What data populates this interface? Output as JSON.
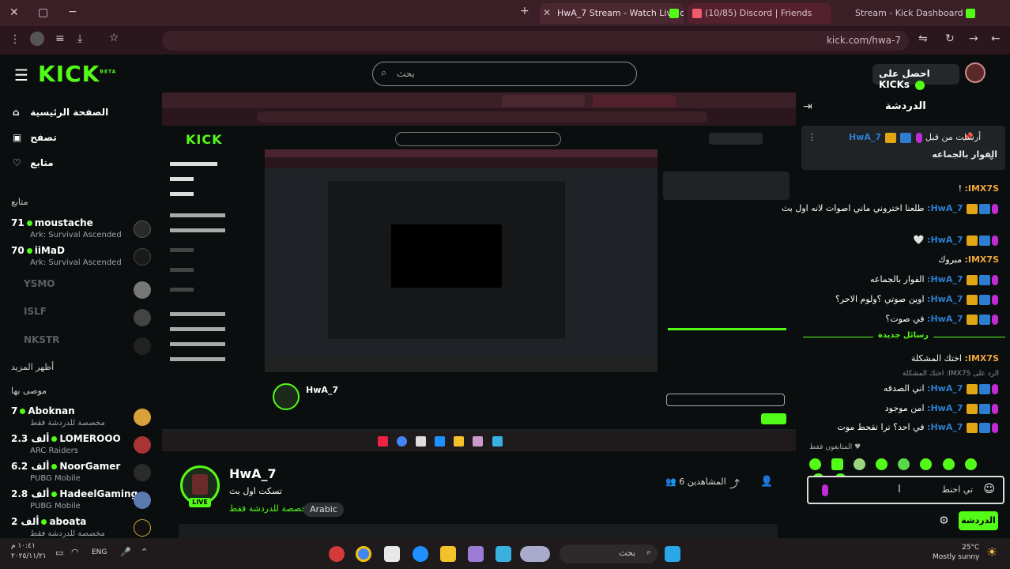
{
  "browser": {
    "tabs": [
      {
        "label": "HwA_7 Stream - Watch Live on",
        "active": true
      },
      {
        "label": "(10/85) Discord | Friends",
        "active": false
      },
      {
        "label": "Stream - Kick Dashboard",
        "active": false
      }
    ],
    "url": "kick.com/hwa-7"
  },
  "header": {
    "logo": "KICK",
    "logo_sup": "BETA",
    "search_placeholder": "بحث",
    "get_kicks_label": "احصل على KICKs"
  },
  "sidebar": {
    "nav": [
      {
        "label": "الصفحة الرئيسية",
        "icon": "home-icon"
      },
      {
        "label": "تصفح",
        "icon": "browse-icon"
      },
      {
        "label": "متابع",
        "icon": "heart-icon"
      }
    ],
    "following_title": "متابع",
    "following": [
      {
        "viewers": "71",
        "name": "moustache",
        "game": "Ark: Survival Ascended",
        "online": true
      },
      {
        "viewers": "70",
        "name": "iiMaD",
        "game": "Ark: Survival Ascended",
        "online": true
      },
      {
        "name": "YSMO",
        "online": false
      },
      {
        "name": "ISLF",
        "online": false
      },
      {
        "name": "NKSTR",
        "online": false
      }
    ],
    "show_more": "أظهر المزيد",
    "recommended_title": "موصى بها",
    "recommended": [
      {
        "viewers": "7",
        "name": "Aboknan",
        "game": "مخصصة للدردشة فقط"
      },
      {
        "viewers": "2.3 ألف",
        "name": "LOMEROOO",
        "game": "ARC Raiders"
      },
      {
        "viewers": "6.2 ألف",
        "name": "NoorGamer",
        "game": "PUBG Mobile"
      },
      {
        "viewers": "2.8 ألف",
        "name": "HadeelGaming",
        "game": "PUBG Mobile"
      },
      {
        "viewers": "2 ألف",
        "name": "aboata",
        "game": "مخصصة للدردشة فقط"
      }
    ]
  },
  "stream": {
    "name": "HwA_7",
    "title": "تسكت اول بث",
    "category": "مخصصة للدردشة فقط",
    "tag": "Arabic",
    "live_label": "LIVE",
    "viewers_label": "المشاهدين 6"
  },
  "chat": {
    "title": "الدردشة",
    "pinned_by": "أرسلت من قبل",
    "pinned_user": "HwA_7",
    "pinned_text": "الفوار بالجماعه",
    "messages": [
      {
        "user": "IMX7S:",
        "text": "!",
        "type": "other"
      },
      {
        "user": "HwA_7:",
        "text": "طلعنا اختروني ماني اصوات لانه اول بث",
        "type": "host"
      },
      {
        "user": "HwA_7:",
        "text": "🤍",
        "type": "host"
      },
      {
        "user": "IMX7S:",
        "text": "مبروك",
        "type": "other"
      },
      {
        "user": "HwA_7:",
        "text": "الفوار بالجماعه",
        "type": "host"
      },
      {
        "user": "HwA_7:",
        "text": "اوين صوتي ؟ولوم الاحر؟",
        "type": "host"
      },
      {
        "user": "HwA_7:",
        "text": "في صوت؟",
        "type": "host"
      }
    ],
    "new_messages_divider": "رسائل جديدة",
    "messages2": [
      {
        "user": "IMX7S:",
        "text": "اختك المشكلة",
        "type": "other"
      },
      {
        "user": "HwA_7:",
        "text": "اني الصدقه",
        "type": "host"
      },
      {
        "user": "HwA_7:",
        "text": "امن موجود",
        "type": "host"
      },
      {
        "user": "HwA_7:",
        "text": "في احد؟ ترا تقحط موت",
        "type": "host"
      }
    ],
    "reply_hint": "الرد على IMX7S: اختك المشكلة",
    "followers_only": "المتابعون فقط",
    "input_placeholder": "تي احنط",
    "send_label": "الدردشة"
  },
  "taskbar": {
    "time": "١٠:٤١ م",
    "date": "٢٠٢٥/١١/٢١",
    "lang": "ENG",
    "search_label": "بحث",
    "weather_temp": "25°C",
    "weather_desc": "Mostly sunny"
  },
  "colors": {
    "kick_green": "#53fc18",
    "tab_bar": "#3a1f27",
    "page_bg": "#0b0e0f",
    "chat_user": "#2d7ed0"
  }
}
